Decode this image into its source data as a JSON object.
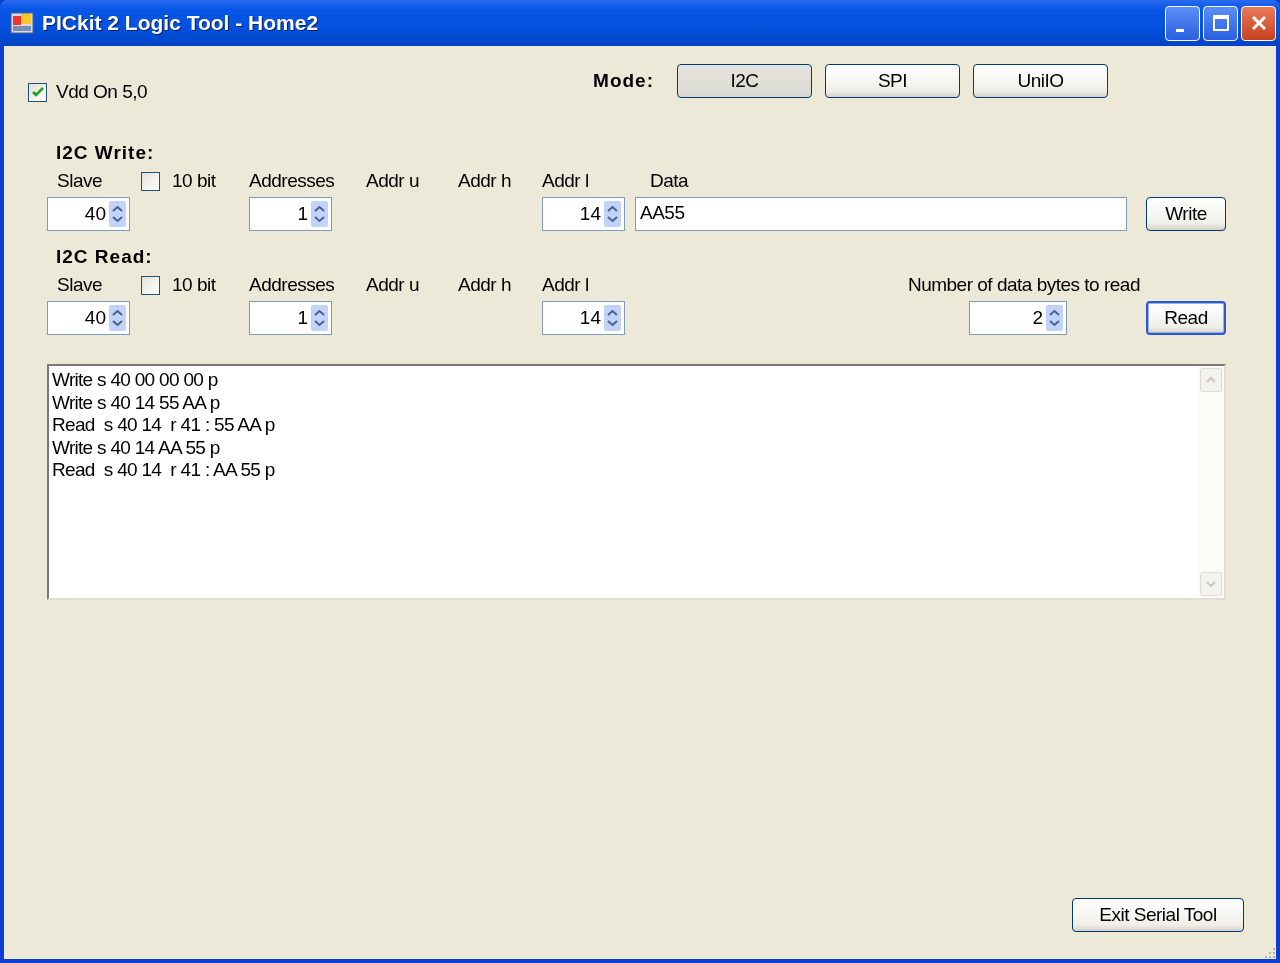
{
  "window": {
    "title": "PICkit 2 Logic Tool - Home2"
  },
  "vdd": {
    "label": "Vdd On 5,0",
    "checked": true
  },
  "mode": {
    "label": "Mode:",
    "buttons": [
      {
        "label": "I2C",
        "selected": true
      },
      {
        "label": "SPI",
        "selected": false
      },
      {
        "label": "UniIO",
        "selected": false
      }
    ]
  },
  "sections": [
    {
      "kind": "write",
      "title": "I2C Write:",
      "slave": {
        "label": "Slave",
        "value": "40"
      },
      "ten_bit": {
        "label": "10 bit",
        "checked": false
      },
      "addresses": {
        "label": "Addresses",
        "value": "1"
      },
      "addr_u": "Addr u",
      "addr_h": "Addr h",
      "addr_l": {
        "label": "Addr l",
        "value": "14"
      },
      "data": {
        "label": "Data",
        "value": "AA55"
      },
      "button": {
        "label": "Write",
        "focused": false
      }
    },
    {
      "kind": "read",
      "title": "I2C Read:",
      "slave": {
        "label": "Slave",
        "value": "40"
      },
      "ten_bit": {
        "label": "10 bit",
        "checked": false
      },
      "addresses": {
        "label": "Addresses",
        "value": "1"
      },
      "addr_u": "Addr u",
      "addr_h": "Addr h",
      "addr_l": {
        "label": "Addr l",
        "value": "14"
      },
      "bytes": {
        "label": "Number of data bytes to read",
        "value": "2"
      },
      "button": {
        "label": "Read",
        "focused": true
      }
    }
  ],
  "log": [
    "Write s 40 00 00 00 p",
    "Write s 40 14 55 AA p",
    "Read  s 40 14  r 41 : 55 AA p",
    "Write s 40 14 AA 55 p",
    "Read  s 40 14  r 41 : AA 55 p"
  ],
  "exit_button": "Exit Serial Tool"
}
